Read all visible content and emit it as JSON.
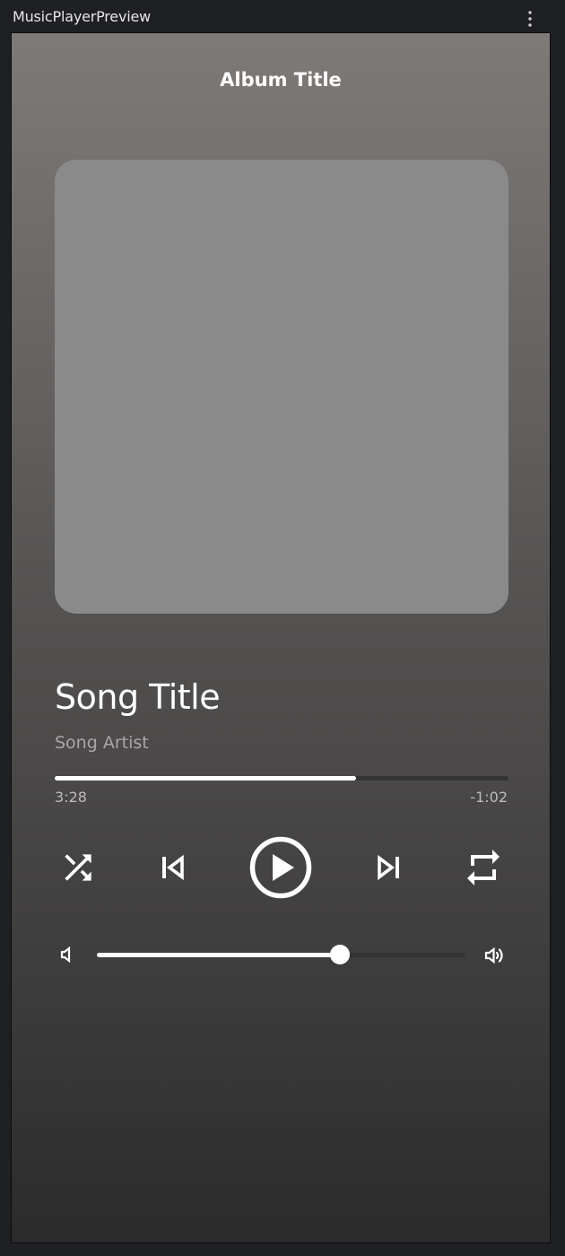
{
  "window": {
    "preview_name": "MusicPlayerPreview"
  },
  "header": {
    "album_title": "Album Title"
  },
  "track": {
    "title": "Song Title",
    "artist": "Song Artist",
    "elapsed": "3:28",
    "remaining": "-1:02",
    "progress": 0.664
  },
  "controls": {
    "shuffle_icon": "shuffle-icon",
    "previous_icon": "skip-previous-icon",
    "play_icon": "play-circle-icon",
    "next_icon": "skip-next-icon",
    "repeat_icon": "repeat-icon"
  },
  "volume": {
    "level": 0.66,
    "low_icon": "volume-low-icon",
    "high_icon": "volume-high-icon"
  },
  "colors": {
    "accent": "#ffffff",
    "track_background": "#343434",
    "artwork_placeholder": "#8a8a8a",
    "background_top": "#7e7a78",
    "background_bottom": "#2b2b2b"
  }
}
